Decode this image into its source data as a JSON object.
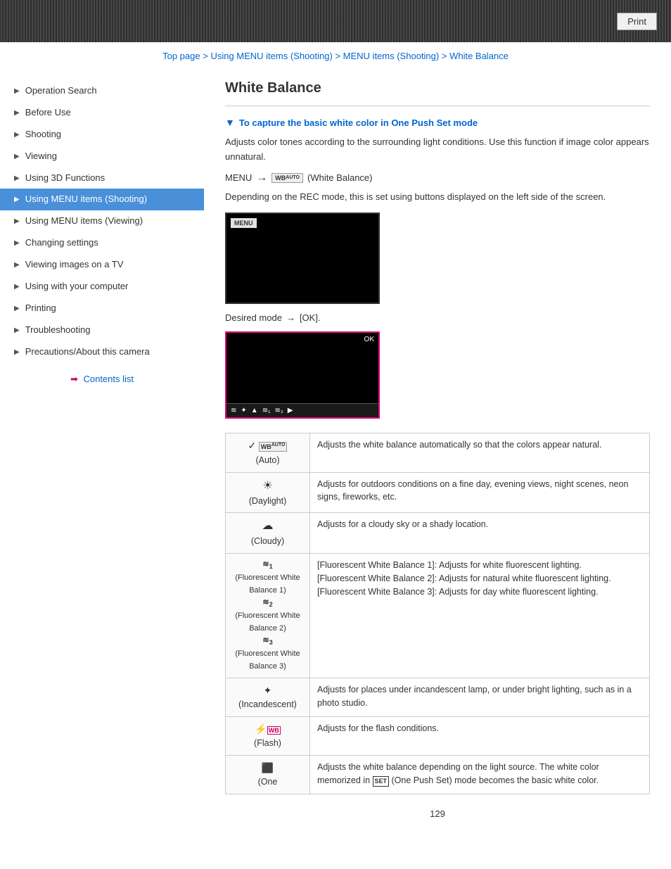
{
  "header": {
    "print_label": "Print"
  },
  "breadcrumb": {
    "top_page": "Top page",
    "sep1": " > ",
    "using_menu": "Using MENU items (Shooting)",
    "sep2": " > ",
    "menu_items": "MENU items (Shooting)",
    "sep3": " > ",
    "white_balance": "White Balance"
  },
  "sidebar": {
    "items": [
      {
        "label": "Operation Search",
        "active": false
      },
      {
        "label": "Before Use",
        "active": false
      },
      {
        "label": "Shooting",
        "active": false
      },
      {
        "label": "Viewing",
        "active": false
      },
      {
        "label": "Using 3D Functions",
        "active": false
      },
      {
        "label": "Using MENU items (Shooting)",
        "active": true
      },
      {
        "label": "Using MENU items (Viewing)",
        "active": false
      },
      {
        "label": "Changing settings",
        "active": false
      },
      {
        "label": "Viewing images on a TV",
        "active": false
      },
      {
        "label": "Using with your computer",
        "active": false
      },
      {
        "label": "Printing",
        "active": false
      },
      {
        "label": "Troubleshooting",
        "active": false
      },
      {
        "label": "Precautions/About this camera",
        "active": false
      }
    ],
    "contents_label": "Contents list"
  },
  "content": {
    "page_title": "White Balance",
    "section_heading": "To capture the basic white color in One Push Set mode",
    "body_text1": "Adjusts color tones according to the surrounding light conditions. Use this function if image color appears unnatural.",
    "menu_instruction": "MENU",
    "wb_label": "WB AUTO (White Balance)",
    "body_text2": "Depending on the REC mode, this is set using buttons displayed on the left side of the screen.",
    "desired_mode_text": "Desired mode",
    "desired_mode_arrow": "→",
    "desired_mode_end": "[OK].",
    "table": {
      "rows": [
        {
          "icon": "✓ WB AUTO",
          "icon_label": "(Auto)",
          "description": "Adjusts the white balance automatically so that the colors appear natural."
        },
        {
          "icon": "☀",
          "icon_label": "(Daylight)",
          "description": "Adjusts for outdoors conditions on a fine day, evening views, night scenes, neon signs, fireworks, etc."
        },
        {
          "icon": "☁",
          "icon_label": "(Cloudy)",
          "description": "Adjusts for a cloudy sky or a shady location."
        },
        {
          "icon": "≋1 (Fluorescent White Balance 1)\n≋2 (Fluorescent White Balance 2)\n≋3 (Fluorescent White Balance 3)",
          "icon_label": "",
          "description": "[Fluorescent White Balance 1]: Adjusts for white fluorescent lighting.\n[Fluorescent White Balance 2]: Adjusts for natural white fluorescent lighting.\n[Fluorescent White Balance 3]: Adjusts for day white fluorescent lighting."
        },
        {
          "icon": "✦",
          "icon_label": "(Incandescent)",
          "description": "Adjusts for places under incandescent lamp, or under bright lighting, such as in a photo studio."
        },
        {
          "icon": "⚡WB",
          "icon_label": "(Flash)",
          "description": "Adjusts for the flash conditions."
        },
        {
          "icon": "⬛",
          "icon_label": "(One",
          "description": "Adjusts the white balance depending on the light source. The white color memorized in SET (One Push Set) mode becomes the basic white color."
        }
      ]
    },
    "page_number": "129"
  }
}
